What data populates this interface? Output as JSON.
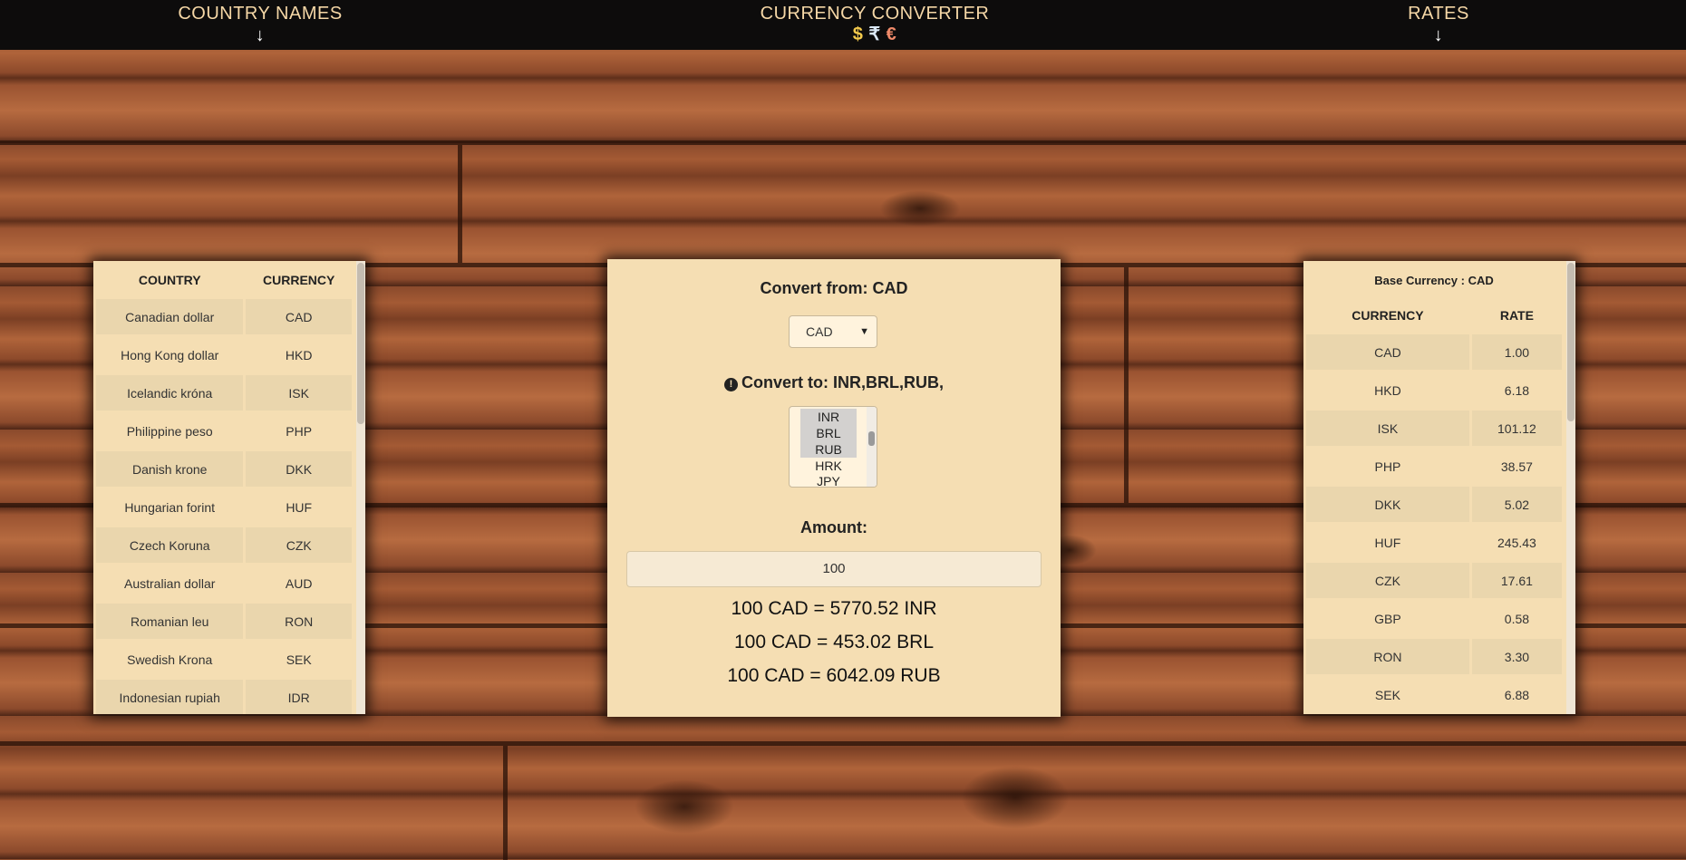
{
  "header": {
    "left_title": "COUNTRY NAMES",
    "center_title": "CURRENCY CONVERTER",
    "right_title": "RATES",
    "arrow": "↓",
    "symbol_dollar": "$",
    "symbol_rupee": "₹",
    "symbol_euro": "€"
  },
  "countries_table": {
    "headers": [
      "COUNTRY",
      "CURRENCY"
    ],
    "rows": [
      [
        "Canadian dollar",
        "CAD"
      ],
      [
        "Hong Kong dollar",
        "HKD"
      ],
      [
        "Icelandic króna",
        "ISK"
      ],
      [
        "Philippine peso",
        "PHP"
      ],
      [
        "Danish krone",
        "DKK"
      ],
      [
        "Hungarian forint",
        "HUF"
      ],
      [
        "Czech Koruna",
        "CZK"
      ],
      [
        "Australian dollar",
        "AUD"
      ],
      [
        "Romanian leu",
        "RON"
      ],
      [
        "Swedish Krona",
        "SEK"
      ],
      [
        "Indonesian rupiah",
        "IDR"
      ]
    ]
  },
  "converter": {
    "convert_from_label": "Convert from: CAD",
    "from_select_value": "CAD",
    "convert_to_label": "Convert to: INR,BRL,RUB,",
    "to_options": [
      "INR",
      "BRL",
      "RUB",
      "HRK",
      "JPY"
    ],
    "to_selected": [
      "INR",
      "BRL",
      "RUB"
    ],
    "amount_label": "Amount:",
    "amount_value": "100",
    "results": [
      "100 CAD = 5770.52 INR",
      "100 CAD = 453.02 BRL",
      "100 CAD = 6042.09 RUB"
    ]
  },
  "rates_table": {
    "caption": "Base Currency : CAD",
    "headers": [
      "CURRENCY",
      "RATE"
    ],
    "rows": [
      [
        "CAD",
        "1.00"
      ],
      [
        "HKD",
        "6.18"
      ],
      [
        "ISK",
        "101.12"
      ],
      [
        "PHP",
        "38.57"
      ],
      [
        "DKK",
        "5.02"
      ],
      [
        "HUF",
        "245.43"
      ],
      [
        "CZK",
        "17.61"
      ],
      [
        "GBP",
        "0.58"
      ],
      [
        "RON",
        "3.30"
      ],
      [
        "SEK",
        "6.88"
      ]
    ]
  },
  "colors": {
    "panel_bg": "#f5deb3",
    "header_bg": "#0d0c0c",
    "header_text": "#f5d7a6",
    "dollar": "#f2c94c",
    "rupee": "#dbe9f6",
    "euro": "#f08a6a"
  }
}
